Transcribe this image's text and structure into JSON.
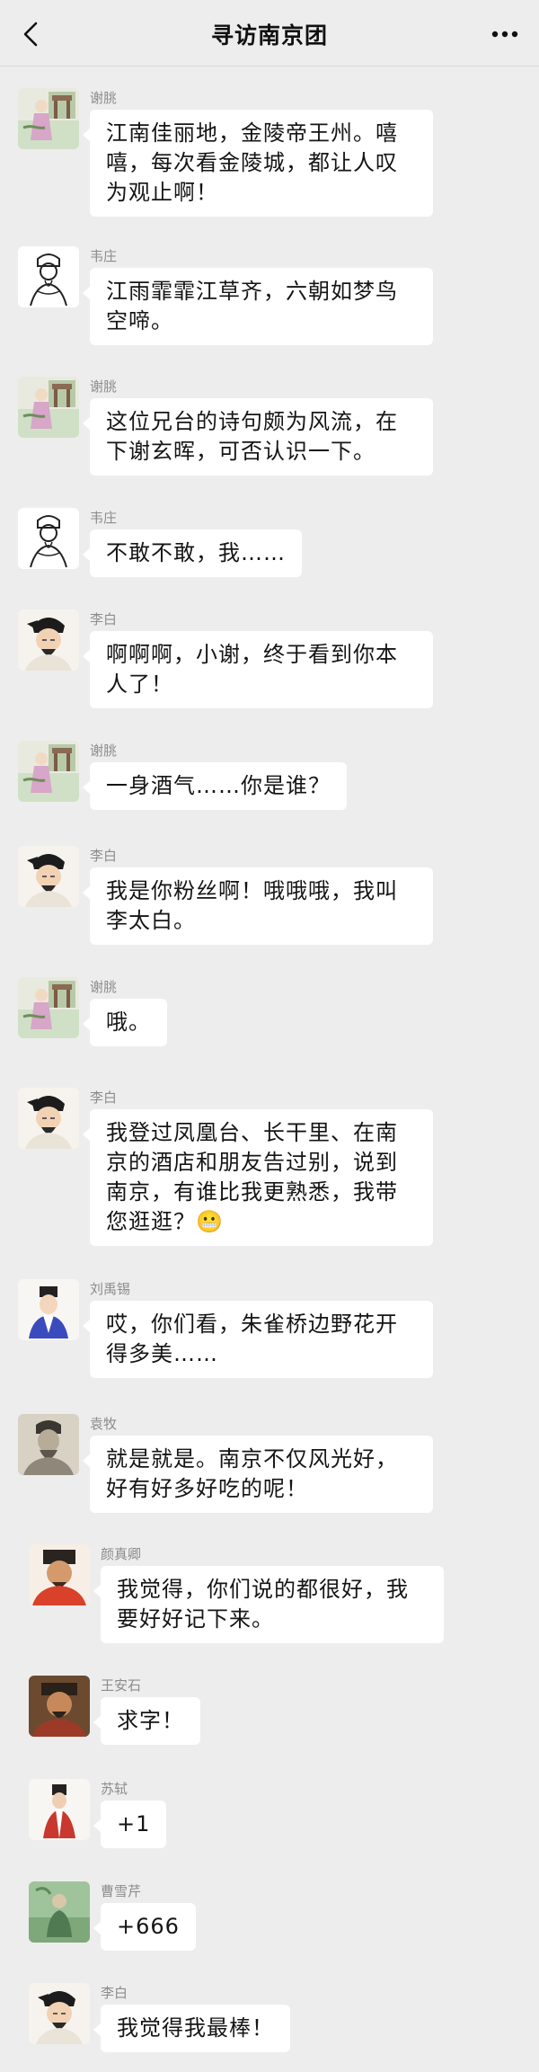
{
  "header": {
    "title": "寻访南京团"
  },
  "messages": [
    {
      "name": "谢朓",
      "avatar": "xietiao-avatar",
      "text": "江南佳丽地，金陵帝王州。嘻嘻，每次看金陵城，都让人叹为观止啊！"
    },
    {
      "name": "韦庄",
      "avatar": "weizhuang-avatar",
      "text": "江雨霏霏江草齐，六朝如梦鸟空啼。"
    },
    {
      "name": "谢朓",
      "avatar": "xietiao-avatar",
      "text": "这位兄台的诗句颇为风流，在下谢玄晖，可否认识一下。"
    },
    {
      "name": "韦庄",
      "avatar": "weizhuang-avatar",
      "text": "不敢不敢，我……"
    },
    {
      "name": "李白",
      "avatar": "libai-avatar",
      "text": "啊啊啊，小谢，终于看到你本人了！"
    },
    {
      "name": "谢朓",
      "avatar": "xietiao-avatar",
      "text": "一身酒气……你是谁？"
    },
    {
      "name": "李白",
      "avatar": "libai-avatar",
      "text": "我是你粉丝啊！哦哦哦，我叫李太白。"
    },
    {
      "name": "谢朓",
      "avatar": "xietiao-avatar",
      "text": "哦。"
    },
    {
      "name": "李白",
      "avatar": "libai-avatar",
      "text": "我登过凤凰台、长干里、在南京的酒店和朋友告过别，说到南京，有谁比我更熟悉，我带您逛逛？😬"
    },
    {
      "name": "刘禹锡",
      "avatar": "liuyuxi-avatar",
      "text": "哎，你们看，朱雀桥边野花开得多美……"
    },
    {
      "name": "袁牧",
      "avatar": "yuanmu-avatar",
      "text": "就是就是。南京不仅风光好，好有好多好吃的呢！"
    },
    {
      "name": "颜真卿",
      "avatar": "yanzhenqing-avatar",
      "text": "我觉得，你们说的都很好，我要好好记下来。"
    },
    {
      "name": "王安石",
      "avatar": "wanganshi-avatar",
      "text": "求字！"
    },
    {
      "name": "苏轼",
      "avatar": "sushi-avatar",
      "text": "+1"
    },
    {
      "name": "曹雪芹",
      "avatar": "caoxueqin-avatar",
      "text": "+666"
    },
    {
      "name": "李白",
      "avatar": "libai-avatar",
      "text": "我觉得我最棒！"
    }
  ]
}
